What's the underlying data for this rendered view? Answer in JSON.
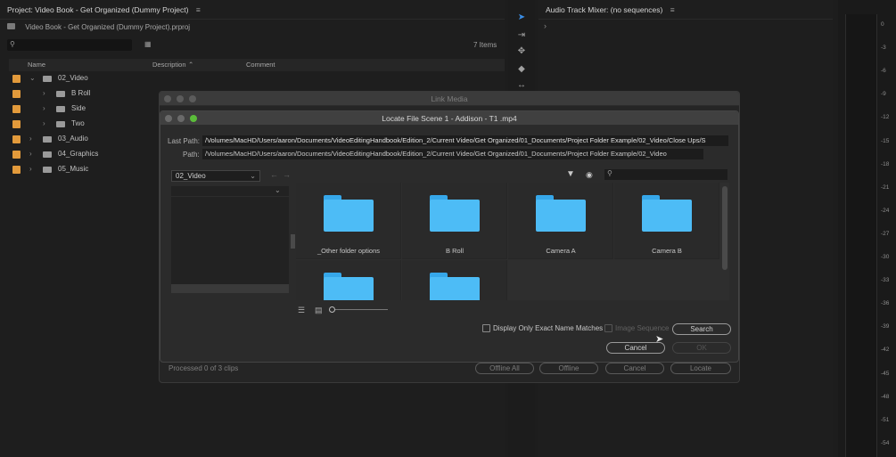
{
  "project": {
    "title": "Project: Video Book - Get Organized (Dummy Project)",
    "file": "Video Book - Get Organized (Dummy Project).prproj",
    "items": "7 Items",
    "columns": {
      "name": "Name",
      "description": "Description",
      "comment": "Comment"
    },
    "tree": [
      {
        "label": "02_Video",
        "arrow": "⌄"
      },
      {
        "label": "B Roll",
        "arrow": "›"
      },
      {
        "label": "Side",
        "arrow": "›"
      },
      {
        "label": "Two",
        "arrow": "›"
      },
      {
        "label": "03_Audio",
        "arrow": "›"
      },
      {
        "label": "04_Graphics",
        "arrow": "›"
      },
      {
        "label": "05_Music",
        "arrow": "›"
      }
    ]
  },
  "mixer": {
    "title": "Audio Track Mixer: (no sequences)"
  },
  "meter_scale": [
    "0",
    "-3",
    "-6",
    "-9",
    "-12",
    "-15",
    "-18",
    "-21",
    "-24",
    "-27",
    "-30",
    "-33",
    "-36",
    "-39",
    "-42",
    "-45",
    "-48",
    "-51",
    "-54"
  ],
  "link_media": {
    "title": "Link Media",
    "processed": "Processed 0 of 3 clips",
    "buttons": {
      "offline_all": "Offline All",
      "offline": "Offline",
      "cancel": "Cancel",
      "locate": "Locate"
    }
  },
  "locate": {
    "title": "Locate File Scene 1 - Addison - T1 .mp4",
    "last_path_label": "Last Path:",
    "last_path": "/Volumes/MacHD/Users/aaron/Documents/VideoEditingHandbook/Edition_2/Current Video/Get Organized/01_Documents/Project Folder Example/02_Video/Close Ups/S",
    "path_label": "Path:",
    "path": "/Volumes/MacHD/Users/aaron/Documents/VideoEditingHandbook/Edition_2/Current Video/Get Organized/01_Documents/Project Folder Example/02_Video",
    "folder_select": "02_Video",
    "folders": [
      "_Other folder options",
      "B Roll",
      "Camera A",
      "Camera B",
      "",
      ""
    ],
    "exact_match_label": "Display Only Exact Name Matches",
    "image_sequence_label": "Image Sequence",
    "search_button": "Search",
    "cancel_button": "Cancel",
    "ok_button": "OK"
  },
  "colors": {
    "label_orange": "#e29a3b",
    "folder_blue": "#4dbcf6",
    "accent": "#3a8ee6",
    "green_light": "#5bbd3a"
  }
}
